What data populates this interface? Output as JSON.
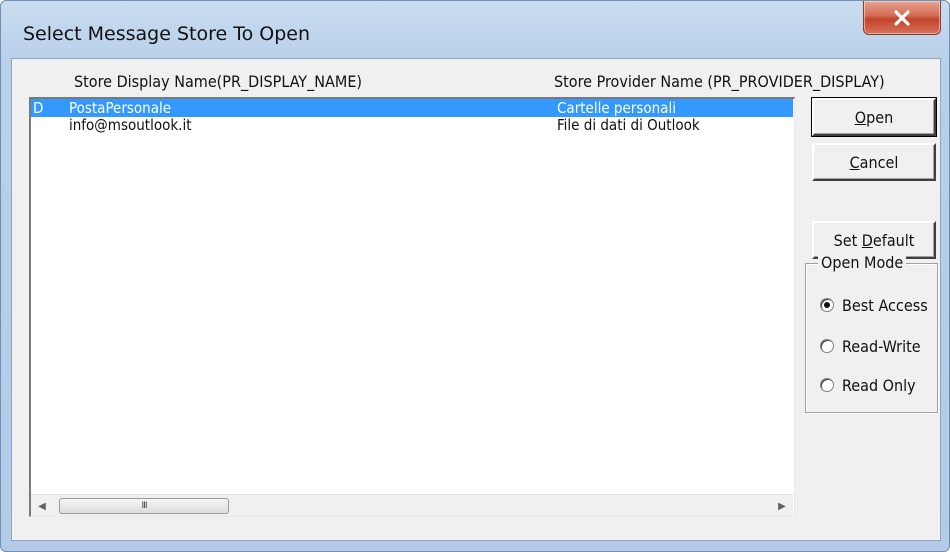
{
  "window": {
    "title": "Select Message Store To Open",
    "close_symbol": "X"
  },
  "list": {
    "columns": [
      "Store Display Name(PR_DISPLAY_NAME)",
      "Store Provider Name (PR_PROVIDER_DISPLAY)"
    ],
    "rows": [
      {
        "flag": "D",
        "name": "PostaPersonale",
        "provider": "Cartelle personali",
        "selected": true
      },
      {
        "flag": "",
        "name": "info@msoutlook.it",
        "provider": "File di dati di Outlook",
        "selected": false
      }
    ],
    "scroll": {
      "left_arrow": "◀",
      "right_arrow": "▶",
      "grip": "III"
    }
  },
  "buttons": {
    "open": {
      "mnemonic": "O",
      "rest": "pen"
    },
    "cancel": {
      "mnemonic": "C",
      "rest": "ancel"
    },
    "set_default": {
      "prefix": "Set ",
      "mnemonic": "D",
      "rest": "efault"
    }
  },
  "open_mode": {
    "legend": "Open Mode",
    "options": [
      {
        "label": "Best Access",
        "selected": true
      },
      {
        "label": "Read-Write",
        "selected": false
      },
      {
        "label": "Read Only",
        "selected": false
      }
    ]
  },
  "colors": {
    "selection": "#3399ff",
    "close_button": "#c3432b",
    "title_bar": "#b9d0ea"
  }
}
